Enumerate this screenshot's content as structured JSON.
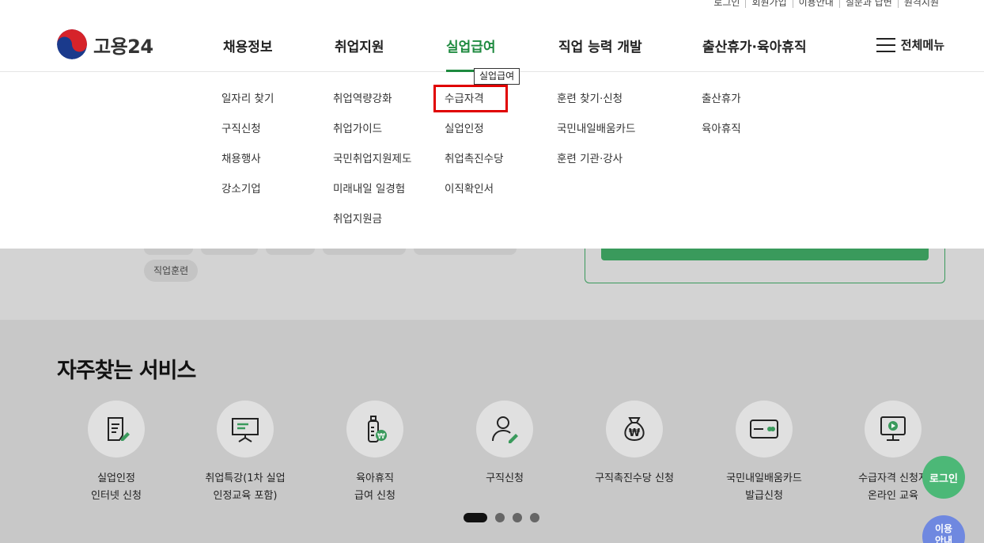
{
  "util_links": [
    "로그인",
    "회원가입",
    "이용안내",
    "질문과 답변",
    "원격지원"
  ],
  "logo": {
    "text": "고용24"
  },
  "gnb": [
    "채용정보",
    "취업지원",
    "실업급여",
    "직업 능력 개발",
    "출산휴가·육아휴직"
  ],
  "gnb_active": "실업급여",
  "all_menu_label": "전체메뉴",
  "dropdown": {
    "col1": [
      "일자리 찾기",
      "구직신청",
      "채용행사",
      "강소기업"
    ],
    "col2": [
      "취업역량강화",
      "취업가이드",
      "국민취업지원제도",
      "미래내일 일경험",
      "취업지원금"
    ],
    "col3": [
      "수급자격",
      "실업인정",
      "취업촉진수당",
      "이직확인서"
    ],
    "col4": [
      "훈련 찾기·신청",
      "국민내일배움카드",
      "훈련 기관·강사"
    ],
    "col5": [
      "출산휴가",
      "육아휴직"
    ]
  },
  "tooltip": "실업급여",
  "tag": "직업훈련",
  "services": {
    "title": "자주찾는 서비스",
    "items": [
      {
        "label": "실업인정\n인터넷 신청",
        "icon": "document-pen-icon"
      },
      {
        "label": "취업특강(1차 실업\n인정교육 포함)",
        "icon": "presentation-board-icon"
      },
      {
        "label": "육아휴직\n급여 신청",
        "icon": "baby-bottle-won-icon"
      },
      {
        "label": "구직신청",
        "icon": "person-pen-icon"
      },
      {
        "label": "구직촉진수당 신청",
        "icon": "money-bag-icon"
      },
      {
        "label": "국민내일배움카드\n발급신청",
        "icon": "card-icon"
      },
      {
        "label": "수급자격 신청자\n온라인 교육",
        "icon": "monitor-play-icon"
      }
    ]
  },
  "float_login": "로그인",
  "float_guide": "이용\n안내",
  "colors": {
    "brand_green": "#1e8a3f",
    "highlight_red": "#e00000"
  }
}
